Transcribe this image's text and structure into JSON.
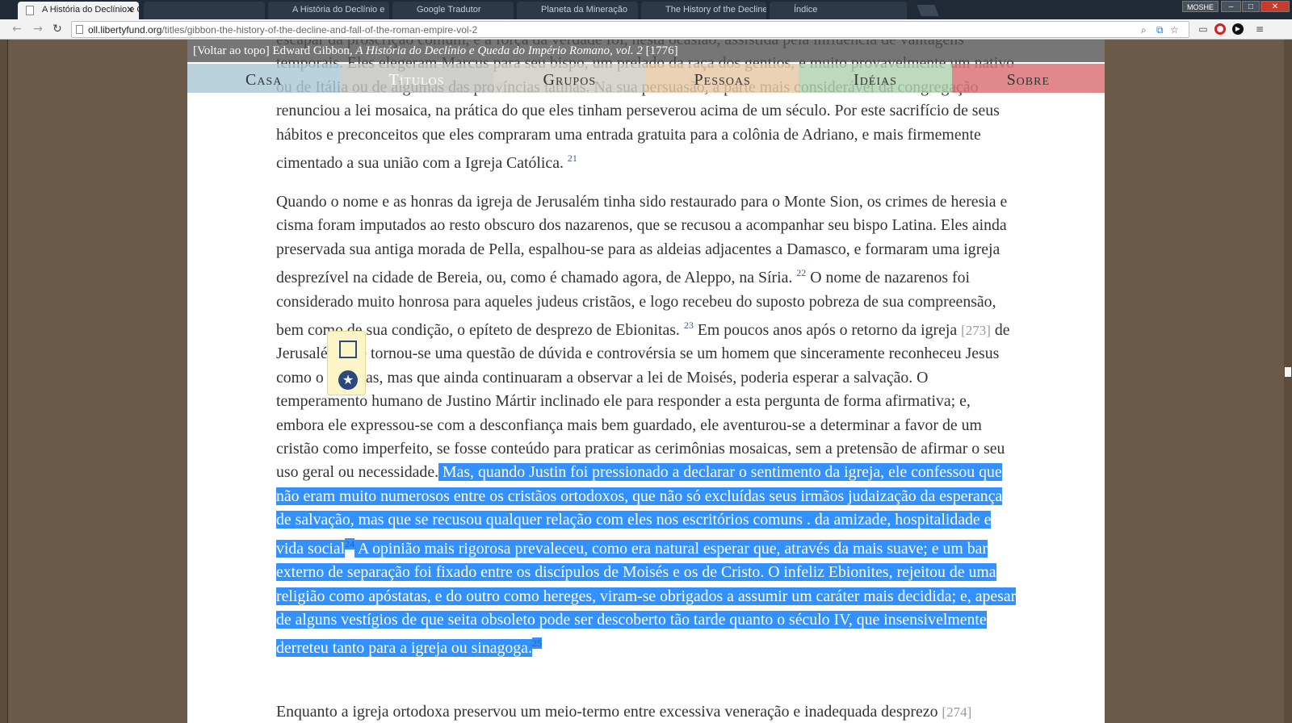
{
  "browser": {
    "tabs": [
      {
        "title": "A História do Declínio e Q",
        "active": true
      },
      {
        "title": "",
        "active": false
      },
      {
        "title": "A História do Declínio e",
        "active": false
      },
      {
        "title": "Google Tradutor",
        "active": false
      },
      {
        "title": "Planeta da Mineração",
        "active": false
      },
      {
        "title": "The History of the Decline",
        "active": false
      },
      {
        "title": "Índice",
        "active": false
      }
    ],
    "close_glyph": "✕",
    "profile_label": "MOSHE",
    "window_buttons": {
      "minimize": "–",
      "maximize": "□",
      "close": "✕"
    },
    "url_host": "oll.libertyfund.org",
    "url_path": "/titles/gibbon-the-history-of-the-decline-and-fall-of-the-roman-empire-vol-2"
  },
  "page": {
    "breadcrumb": {
      "back_to_top": "[Voltar ao topo]",
      "author": " Edward Gibbon, ",
      "title": "A História do Declínio e Queda do Império Romano, vol. 2",
      "year": " [1776]"
    },
    "nav": [
      "Casa",
      "Títulos",
      "Grupos",
      "Pessoas",
      "Idéias",
      "Sobre"
    ],
    "para_top": {
      "text": "escapar da proscrição comum, e a força da verdade foi, nesta ocasião, assistida pela influência de vantagens temporais. Eles elegeram Marcus para seu bispo, um prelado da raça dos gentios, e muito provavelmente um nativo ou de Itália ou de algumas das províncias latinas. Na sua persuasão, a parte mais considerável da congregação renunciou a lei mosaica, na prática do que eles tinham perseverou acima de um século. Por este sacrifício de seus hábitos e preconceitos que eles compraram uma entrada gratuita para a colônia de Adriano, e mais firmemente cimentado a sua união com a Igreja Católica.",
      "fn": "21"
    },
    "para_mid": {
      "t1": "Quando o nome e as honras da igreja de Jerusalém tinha sido restaurado para o Monte Sion, os crimes de heresia e cisma foram imputados ao resto obscuro dos nazarenos, que se recusou a acompanhar seu bispo Latina. Eles ainda preservada sua antiga morada de Pella, espalhou-se para as aldeias adjacentes a Damasco, e formaram uma igreja desprezível na cidade de Bereia, ou, como é chamado agora, de Aleppo, na Síria.",
      "fn22": "22",
      "t2": " O nome de nazarenos foi considerado muito honrosa para aqueles judeus cristãos, e logo recebeu do suposto pobreza de sua compreensão, bem como de sua condição, o epíteto de desprezo de Ebionitas.",
      "fn23": "23",
      "t3": " Em poucos anos após o retorno da igreja ",
      "pg273": "[273]",
      "t4": " de Jerusalém, ele tornou-se uma questão de dúvida e controvérsia se um homem que sinceramente reconheceu Jesus como o Messias, mas que ainda continuaram a observar a lei de Moisés, poderia esperar a salvação. O temperamento humano de Justino Mártir inclinado ele para responder a esta pergunta de forma afirmativa; e, embora ele expressou-se com a desconfiança mais bem guardado, ele aventurou-se a determinar a favor de um cristão como imperfeito, se fosse conteúdo para praticar as cerimônias mosaicas, sem a pretensão de afirmar o seu uso geral ou necessidade.",
      "sel1": " Mas, quando Justin foi pressionado a declarar o sentimento da igreja, ele confessou que não eram muito numerosos entre os cristãos ortodoxos, que não só excluídas seus irmãos judaização da esperança de salvação, mas que se recusou qualquer relação com eles nos escritórios comuns . da amizade, hospitalidade e vida social",
      "fn24": "24",
      "sel2": " A opinião mais rigorosa prevaleceu, como era natural esperar que, através da mais suave; e um bar externo de separação foi fixado entre os discípulos de Moisés e os de Cristo. O infeliz Ebionites, rejeitou de uma religião como apóstatas, e do outro como hereges, viram-se obrigados a assumir um caráter mais decidida; e, apesar de alguns vestígios de que seita obsoleto pode ser descoberto tão tarde quanto o século IV, que insensivelmente derreteu tanto para a igreja ou sinagoga.",
      "fn25": "25"
    },
    "para_bot": {
      "text": "Enquanto a igreja ortodoxa preservou um meio-termo entre excessiva veneração e inadequada desprezo",
      "pg": "[274]"
    },
    "popup_icons": [
      "checkbox-icon",
      "star-icon"
    ]
  },
  "colors": {
    "selection": "#3390ff",
    "nav_sobre": "#dc7378",
    "background": "#6b5a48"
  }
}
